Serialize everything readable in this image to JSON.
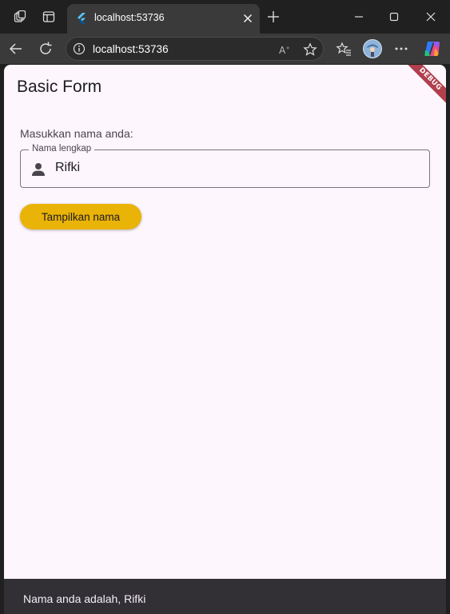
{
  "browser": {
    "tab_title": "localhost:53736",
    "address": "localhost:53736",
    "accent_color": "#3a3a3a"
  },
  "app": {
    "title": "Basic Form",
    "debug_banner": "DEBUG",
    "prompt_label": "Masukkan nama anda:",
    "field": {
      "label": "Nama lengkap",
      "value": "Rifki",
      "icon": "person-icon"
    },
    "button_label": "Tampilkan nama",
    "button_color": "#eab308",
    "snackbar_text": "Nama anda adalah, Rifki"
  }
}
